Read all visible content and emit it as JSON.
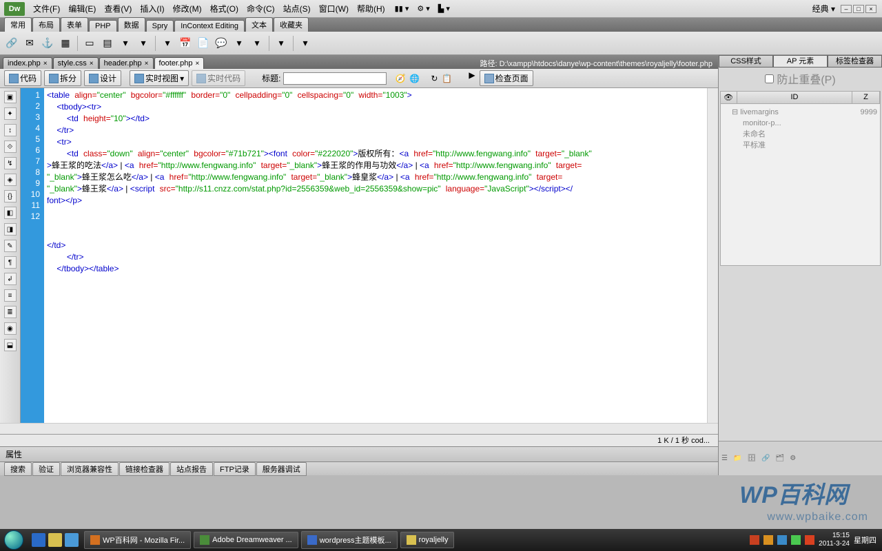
{
  "menubar": {
    "logo": "Dw",
    "items": [
      "文件(F)",
      "编辑(E)",
      "查看(V)",
      "插入(I)",
      "修改(M)",
      "格式(O)",
      "命令(C)",
      "站点(S)",
      "窗口(W)",
      "帮助(H)"
    ],
    "workspace": "经典"
  },
  "cat_tabs": [
    "常用",
    "布局",
    "表单",
    "PHP",
    "数据",
    "Spry",
    "InContext Editing",
    "文本",
    "收藏夹"
  ],
  "file_tabs": [
    {
      "name": "index.php",
      "active": false
    },
    {
      "name": "style.css",
      "active": false
    },
    {
      "name": "header.php",
      "active": false
    },
    {
      "name": "footer.php",
      "active": true
    }
  ],
  "path_label": "路径:",
  "path_value": "D:\\xampp\\htdocs\\danye\\wp-content\\themes\\royaljelly\\footer.php",
  "view_toolbar": {
    "code": "代码",
    "split": "拆分",
    "design": "设计",
    "live_view": "实时视图",
    "live_code": "实时代码",
    "title_label": "标题:",
    "check_page": "检查页面"
  },
  "gutter_lines": [
    "1",
    "2",
    "3",
    "4",
    "5",
    "6",
    "",
    "",
    "",
    "7",
    "8",
    "9",
    "10",
    "11",
    "12"
  ],
  "status": "1 K / 1 秒    cod...",
  "right_panel": {
    "tabs": [
      "CSS样式",
      "AP 元素",
      "标签检查器"
    ],
    "checkbox": "防止重叠(P)",
    "headers": [
      "",
      "ID",
      "Z"
    ],
    "tree": [
      {
        "name": "livemargins",
        "z": "9999",
        "indent": 0
      },
      {
        "name": "monitor-p...",
        "z": "",
        "indent": 1
      },
      {
        "name": "未命名",
        "z": "",
        "indent": 1
      },
      {
        "name": "平标准",
        "z": "",
        "indent": 1
      }
    ]
  },
  "bottom_prop": "属性",
  "bottom_tabs": [
    "搜索",
    "验证",
    "浏览器兼容性",
    "链接检查器",
    "站点报告",
    "FTP记录",
    "服务器调试"
  ],
  "taskbar": {
    "items": [
      {
        "label": "WP百科网 - Mozilla Fir...",
        "color": "#d47020"
      },
      {
        "label": "Adobe Dreamweaver ...",
        "color": "#4a8c3a"
      },
      {
        "label": "wordpress主题模板...",
        "color": "#3a6ac8"
      },
      {
        "label": "royaljelly",
        "color": "#d8c050"
      }
    ],
    "time": "15:15",
    "date": "2011-3-24",
    "day": "星期四"
  },
  "toolbar_icons": [
    "link-icon",
    "email-icon",
    "anchor-icon",
    "table-icon",
    "hr-icon",
    "div-icon",
    "layout-icon",
    "nav-icon",
    "image-icon",
    "flash-icon",
    "date-icon",
    "comment-icon",
    "script-icon",
    "template-icon",
    "tag-icon",
    "more-icon",
    "more2-icon"
  ],
  "vtoolbar_icons": [
    "collapse-icon",
    "expand-icon",
    "select-icon",
    "balance-icon",
    "linenum-icon",
    "highlight-icon",
    "syntax-icon",
    "indent-icon",
    "outdent-icon",
    "format-icon",
    "comment-icon",
    "wrap-icon",
    "recent-icon",
    "snippet-icon",
    "ref-icon",
    "css-icon"
  ]
}
